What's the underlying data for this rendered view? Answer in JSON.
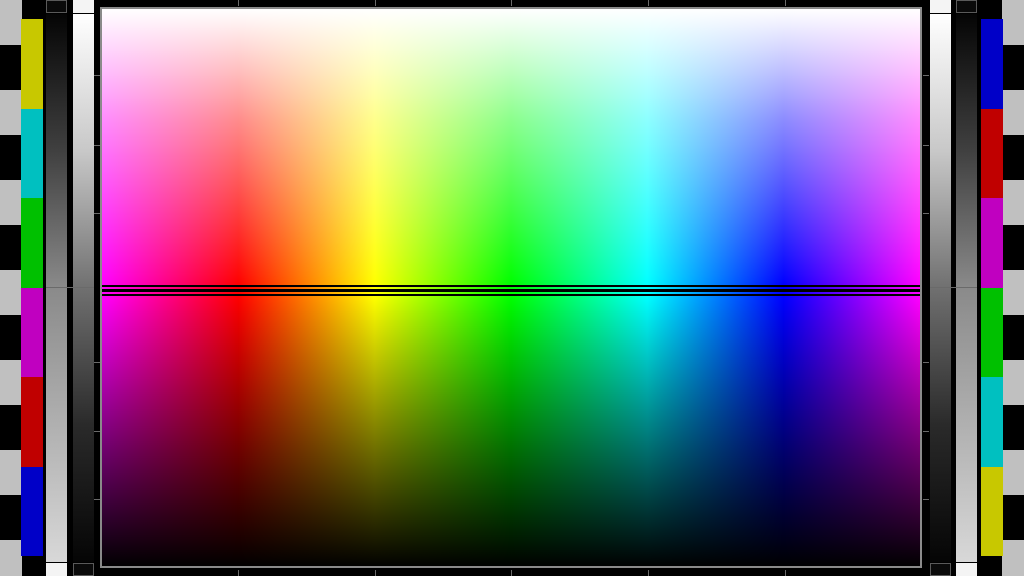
{
  "test_pattern": {
    "left_color_bars": [
      {
        "name": "yellow",
        "color": "#c8c800"
      },
      {
        "name": "cyan",
        "color": "#00c0c0"
      },
      {
        "name": "green",
        "color": "#00c000"
      },
      {
        "name": "magenta",
        "color": "#c000c0"
      },
      {
        "name": "red",
        "color": "#c00000"
      },
      {
        "name": "blue",
        "color": "#0000c8"
      }
    ],
    "right_color_bars": [
      {
        "name": "blue",
        "color": "#0000c8"
      },
      {
        "name": "red",
        "color": "#c00000"
      },
      {
        "name": "magenta",
        "color": "#c000c0"
      },
      {
        "name": "green",
        "color": "#00c000"
      },
      {
        "name": "cyan",
        "color": "#00c0c0"
      },
      {
        "name": "yellow",
        "color": "#c8c800"
      }
    ],
    "spectrum_hues": [
      "#ff00ff",
      "#ff0000",
      "#ffff00",
      "#00ff00",
      "#00ffff",
      "#0000ff",
      "#ff00ff"
    ],
    "checker_colors": [
      "#c0c0c0",
      "#000000"
    ],
    "panel_border_color": "#8a8a8a"
  }
}
